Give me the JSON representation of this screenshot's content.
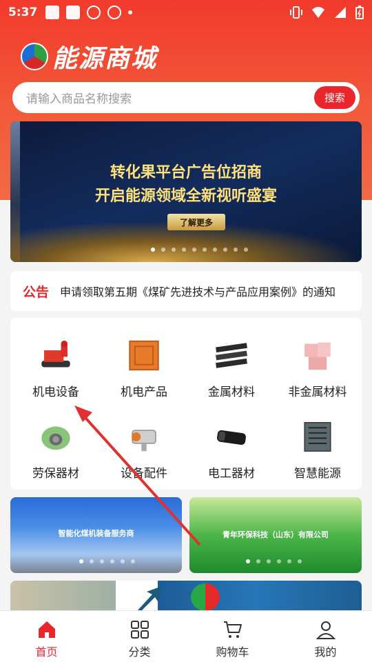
{
  "status_bar": {
    "time": "5:37"
  },
  "header": {
    "logo_text": "能源商城"
  },
  "search": {
    "placeholder": "请输入商品名称搜索",
    "button_label": "搜索"
  },
  "banner": {
    "line1": "转化果平台广告位招商",
    "line2": "开启能源领域全新视听盛宴",
    "button_label": "了解更多",
    "dot_count": 10,
    "active_dot": 0
  },
  "notice": {
    "label": "公告",
    "text": "申请领取第五期《煤矿先进技术与产品应用案例》的通知"
  },
  "categories": [
    {
      "label": "机电设备",
      "icon": "mining-machine-icon"
    },
    {
      "label": "机电产品",
      "icon": "electrical-box-icon"
    },
    {
      "label": "金属材料",
      "icon": "metal-rails-icon"
    },
    {
      "label": "非金属材料",
      "icon": "bricks-icon"
    },
    {
      "label": "劳保器材",
      "icon": "respirator-mask-icon"
    },
    {
      "label": "设备配件",
      "icon": "camera-part-icon"
    },
    {
      "label": "电工器材",
      "icon": "battery-icon"
    },
    {
      "label": "智慧能源",
      "icon": "server-cabinet-icon"
    }
  ],
  "promos": {
    "left_text": "智能化煤机装备服务商",
    "right_text": "青年环保科技（山东）有限公司"
  },
  "tabbar": [
    {
      "label": "首页",
      "icon": "home-icon",
      "active": true
    },
    {
      "label": "分类",
      "icon": "grid-icon",
      "active": false
    },
    {
      "label": "购物车",
      "icon": "cart-icon",
      "active": false
    },
    {
      "label": "我的",
      "icon": "user-icon",
      "active": false
    }
  ],
  "colors": {
    "accent": "#e8262b",
    "header_red": "#f23a2c"
  }
}
